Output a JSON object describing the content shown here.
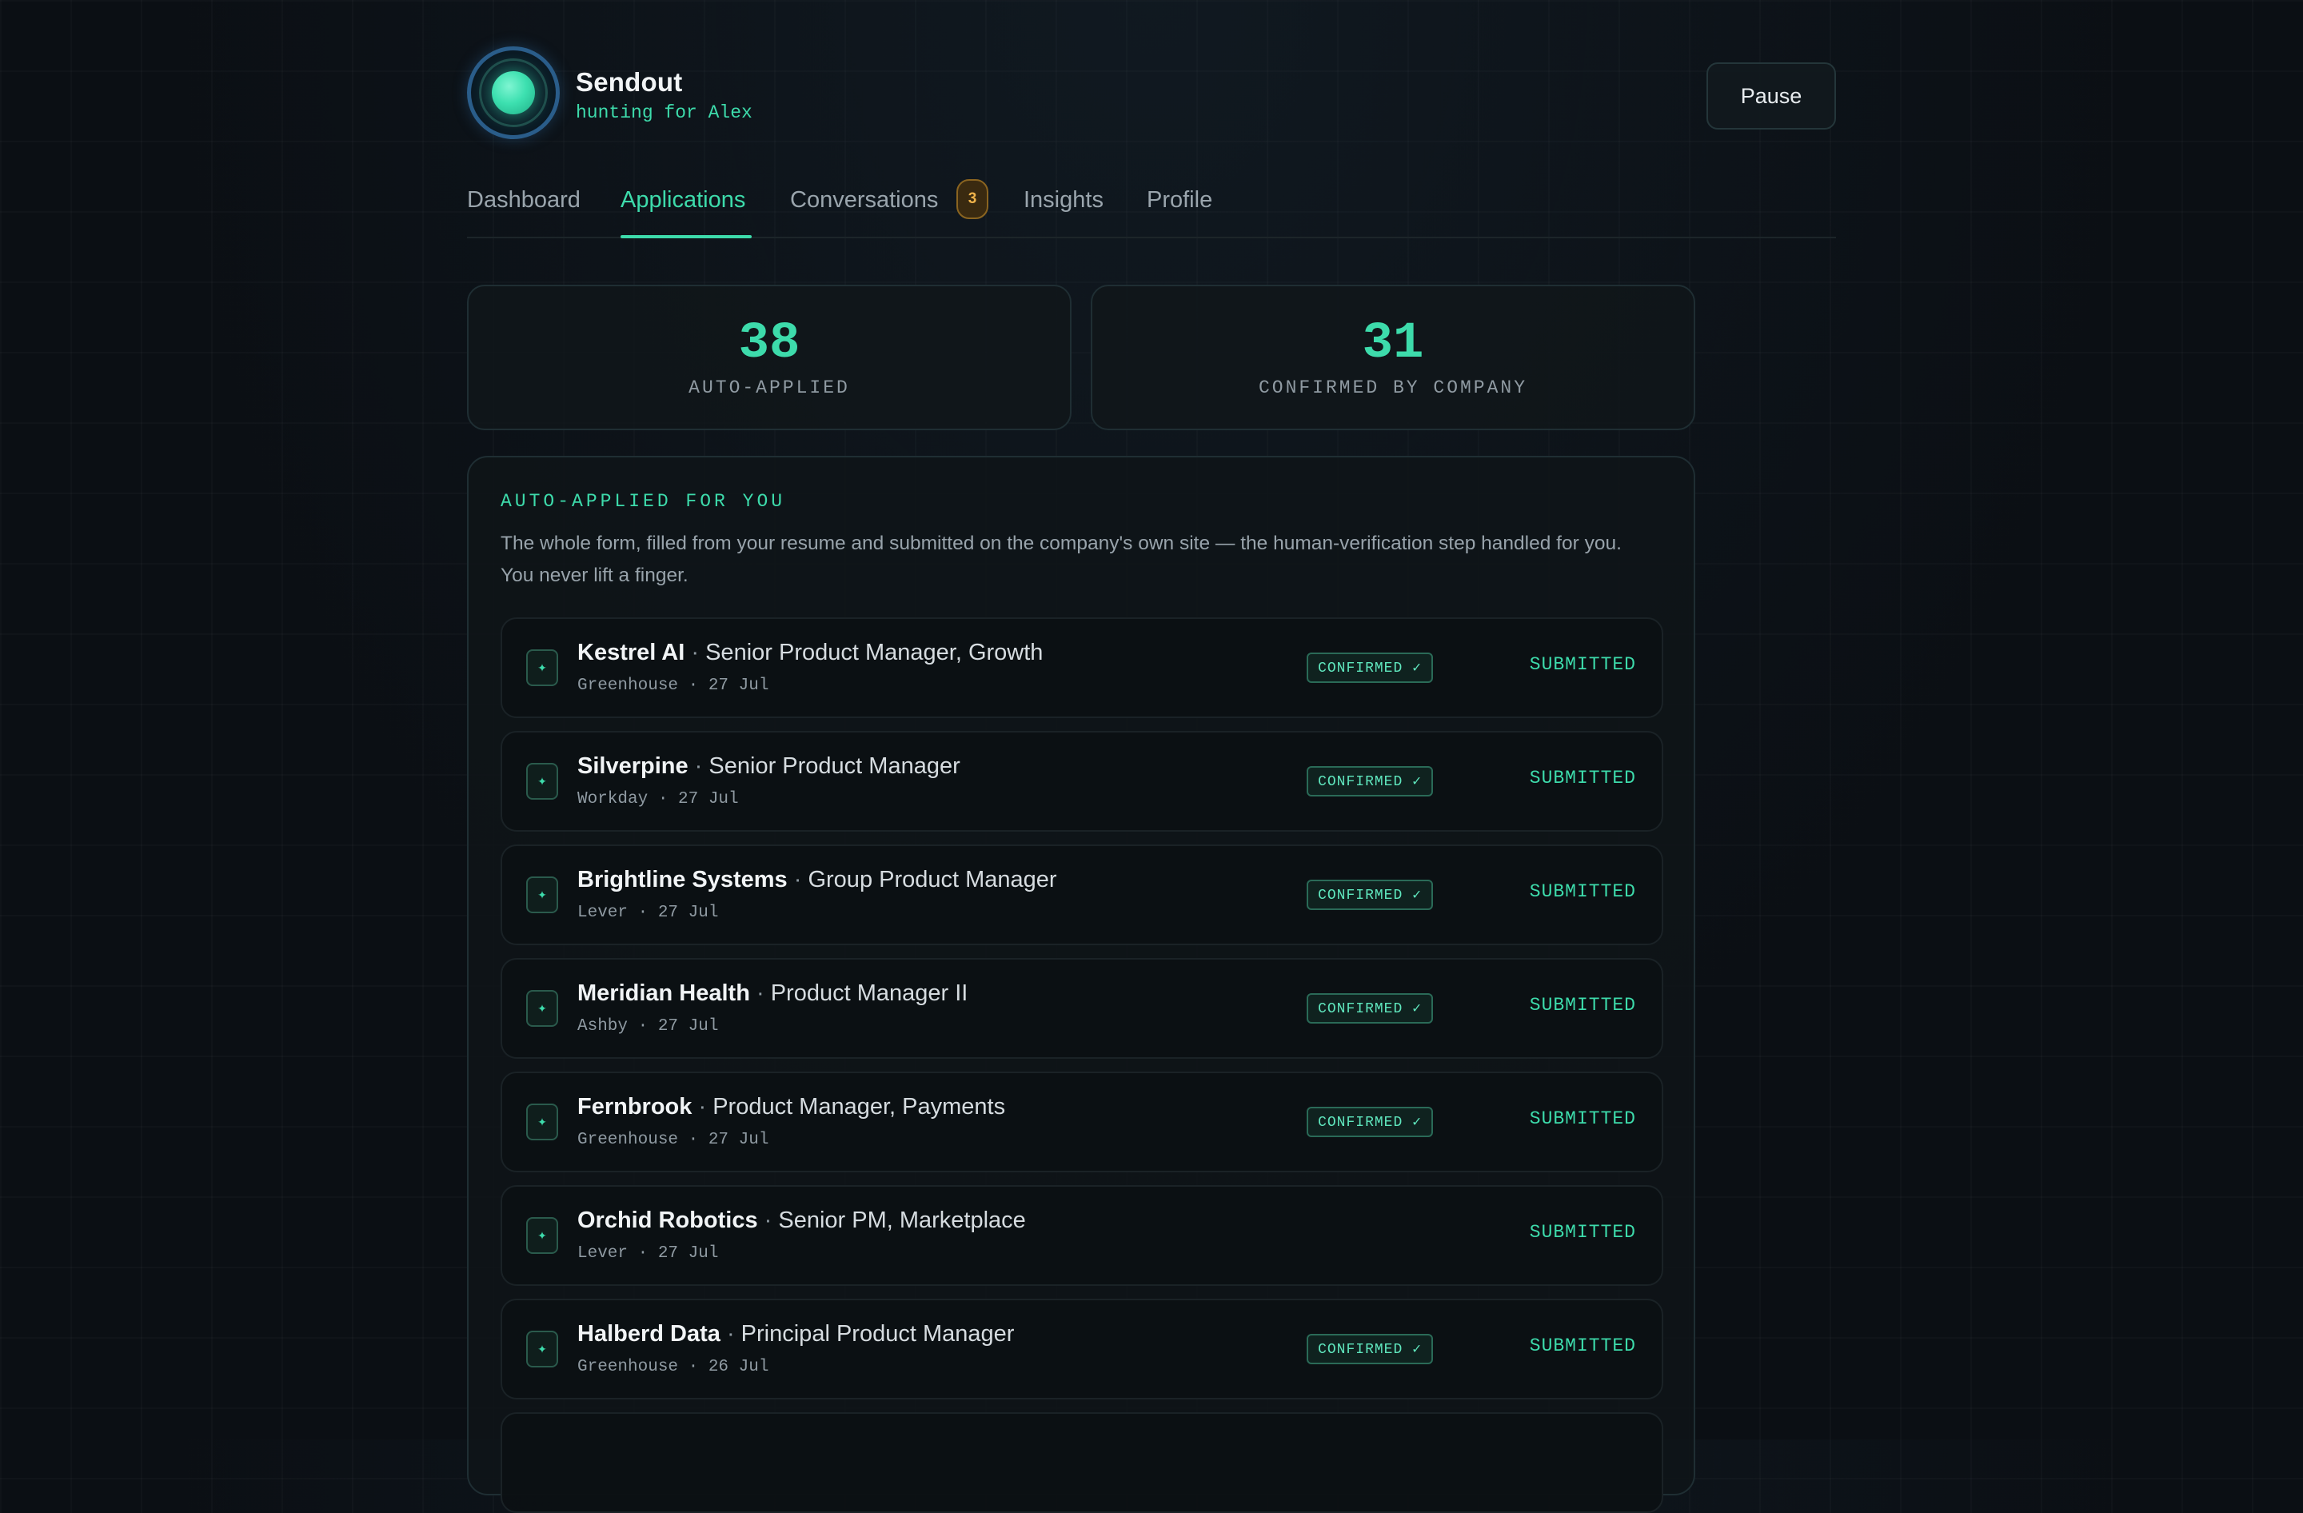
{
  "brand": {
    "name": "Sendout",
    "subtitle": "hunting for Alex",
    "logo_icon": "glowing-orb-icon"
  },
  "header": {
    "pause_label": "Pause"
  },
  "tabs": [
    {
      "label": "Dashboard",
      "active": false
    },
    {
      "label": "Applications",
      "active": true
    },
    {
      "label": "Conversations",
      "active": false,
      "badge": "3"
    },
    {
      "label": "Insights",
      "active": false
    },
    {
      "label": "Profile",
      "active": false
    }
  ],
  "stats": [
    {
      "value": "38",
      "label": "AUTO-APPLIED"
    },
    {
      "value": "31",
      "label": "CONFIRMED BY COMPANY"
    }
  ],
  "panel": {
    "title": "AUTO-APPLIED FOR YOU",
    "description": "The whole form, filled from your resume and submitted on the company's own site — the human-verification step handled for you. You never lift a finger."
  },
  "applications": [
    {
      "company": "Kestrel AI",
      "separator": " · ",
      "role": "Senior Product Manager, Growth",
      "meta": "Greenhouse · 27 Jul",
      "confirmed": "CONFIRMED ✓",
      "status": "SUBMITTED",
      "icon": "sparkle-icon"
    },
    {
      "company": "Silverpine",
      "separator": " · ",
      "role": "Senior Product Manager",
      "meta": "Workday · 27 Jul",
      "confirmed": "CONFIRMED ✓",
      "status": "SUBMITTED",
      "icon": "sparkle-icon"
    },
    {
      "company": "Brightline Systems",
      "separator": " · ",
      "role": "Group Product Manager",
      "meta": "Lever · 27 Jul",
      "confirmed": "CONFIRMED ✓",
      "status": "SUBMITTED",
      "icon": "sparkle-icon"
    },
    {
      "company": "Meridian Health",
      "separator": " · ",
      "role": "Product Manager II",
      "meta": "Ashby · 27 Jul",
      "confirmed": "CONFIRMED ✓",
      "status": "SUBMITTED",
      "icon": "sparkle-icon"
    },
    {
      "company": "Fernbrook",
      "separator": " · ",
      "role": "Product Manager, Payments",
      "meta": "Greenhouse · 27 Jul",
      "confirmed": "CONFIRMED ✓",
      "status": "SUBMITTED",
      "icon": "sparkle-icon"
    },
    {
      "company": "Orchid Robotics",
      "separator": " · ",
      "role": "Senior PM, Marketplace",
      "meta": "Lever · 27 Jul",
      "confirmed": "",
      "status": "SUBMITTED",
      "icon": "sparkle-icon"
    },
    {
      "company": "Halberd Data",
      "separator": " · ",
      "role": "Principal Product Manager",
      "meta": "Greenhouse · 26 Jul",
      "confirmed": "CONFIRMED ✓",
      "status": "SUBMITTED",
      "icon": "sparkle-icon"
    }
  ],
  "colors": {
    "accent": "#3ddbab",
    "background": "#0b0f14",
    "badge_amber": "#f0b34a",
    "logo_ring": "#2a5d8a"
  }
}
